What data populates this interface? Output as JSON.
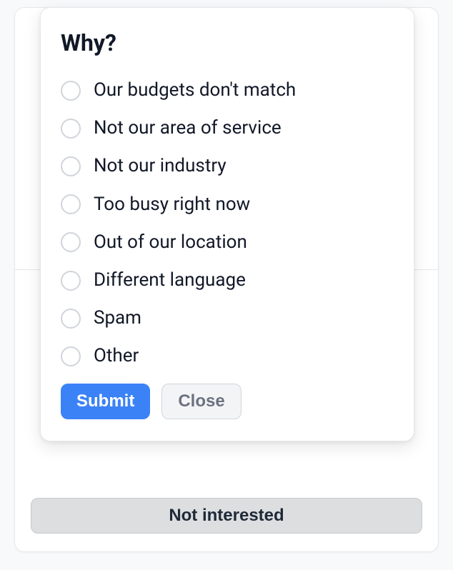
{
  "background": {
    "not_interested_label": "Not interested"
  },
  "popover": {
    "title": "Why?",
    "options": [
      {
        "label": "Our budgets don't match"
      },
      {
        "label": "Not our area of service"
      },
      {
        "label": "Not our industry"
      },
      {
        "label": "Too busy right now"
      },
      {
        "label": "Out of our location"
      },
      {
        "label": "Different language"
      },
      {
        "label": "Spam"
      },
      {
        "label": "Other"
      }
    ],
    "submit_label": "Submit",
    "close_label": "Close"
  }
}
